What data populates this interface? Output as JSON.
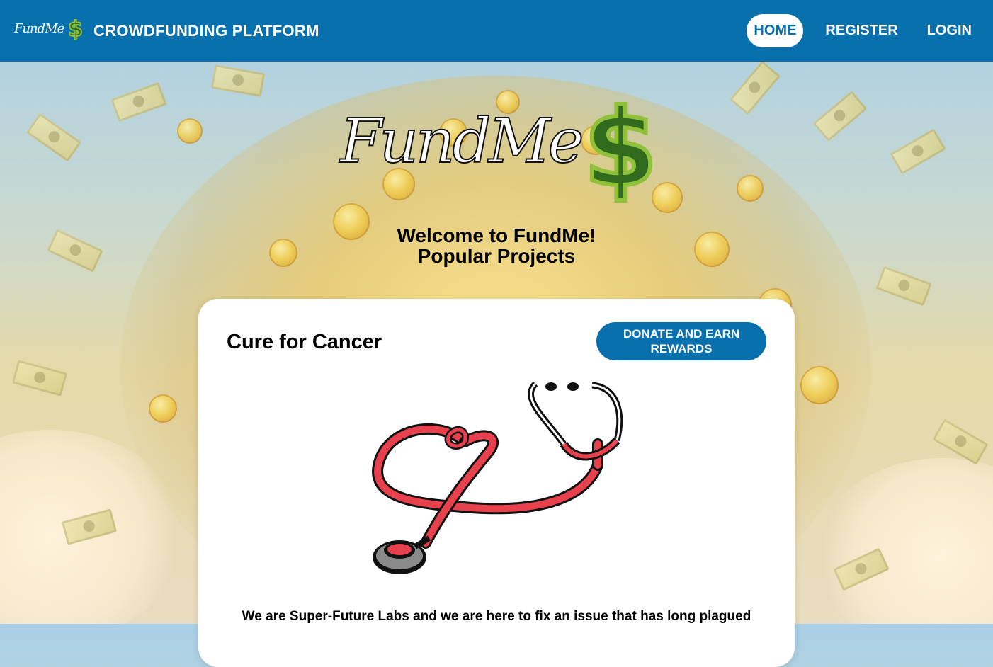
{
  "navbar": {
    "logo_text": "FundMe",
    "logo_symbol": "$",
    "title": "CROWDFUNDING PLATFORM",
    "items": [
      {
        "label": "HOME",
        "active": true
      },
      {
        "label": "REGISTER",
        "active": false
      },
      {
        "label": "LOGIN",
        "active": false
      }
    ]
  },
  "hero": {
    "logo_text": "FundMe",
    "logo_symbol": "$",
    "welcome": "Welcome to FundMe!",
    "subtitle": "Popular Projects"
  },
  "project": {
    "title": "Cure for Cancer",
    "donate_label": "DONATE AND EARN REWARDS",
    "image": "stethoscope-heart-icon",
    "description": "We are Super-Future Labs and we are here to fix an issue that has long plagued"
  },
  "colors": {
    "primary": "#0870ad",
    "card_bg": "#ffffff",
    "stethoscope_red": "#e8414e",
    "logo_green": "#2f6a1d",
    "logo_green_light": "#8fc13a"
  }
}
